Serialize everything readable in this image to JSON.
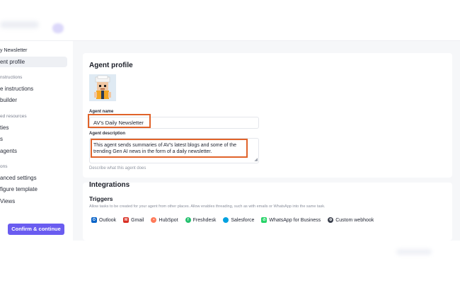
{
  "sidebar": {
    "items": [
      {
        "label": "y Newsletter",
        "kind": "item"
      },
      {
        "label": "ent profile",
        "kind": "item",
        "active": true
      },
      {
        "label": "nstructions",
        "kind": "section"
      },
      {
        "label": "e instructions",
        "kind": "item"
      },
      {
        "label": "builder",
        "kind": "item"
      },
      {
        "label": "ed resources",
        "kind": "section"
      },
      {
        "label": "ties",
        "kind": "item"
      },
      {
        "label": "s",
        "kind": "item"
      },
      {
        "label": "agents",
        "kind": "item"
      },
      {
        "label": "ons",
        "kind": "section"
      },
      {
        "label": "anced settings",
        "kind": "item"
      },
      {
        "label": "figure template",
        "kind": "item"
      },
      {
        "label": "Views",
        "kind": "item"
      }
    ],
    "confirm_label": "Confirm & continue"
  },
  "profile": {
    "heading": "Agent profile",
    "name_label": "Agent name",
    "name_value": "AV's Daily Newsletter",
    "desc_label": "Agent description",
    "desc_value": "This agent sends summaries of AV's latest blogs and some of the trending Gen AI news in the form of a daily newsletter.",
    "helper": "Describe what this agent does"
  },
  "integrations": {
    "heading": "Integrations",
    "triggers_heading": "Triggers",
    "triggers_desc": "Allow tasks to be created for your agent from other places. Allow enables threading, such as with emails or WhatsApp into the same task.",
    "triggers": [
      {
        "label": "Outlook",
        "icon": "outlook-icon",
        "color": "#0a64c8"
      },
      {
        "label": "Gmail",
        "icon": "gmail-icon",
        "color": "#d93025"
      },
      {
        "label": "HubSpot",
        "icon": "hubspot-icon",
        "color": "#ff7a59"
      },
      {
        "label": "Freshdesk",
        "icon": "freshdesk-icon",
        "color": "#25c16f"
      },
      {
        "label": "Salesforce",
        "icon": "salesforce-icon",
        "color": "#00a1e0"
      },
      {
        "label": "WhatsApp for Business",
        "icon": "whatsapp-icon",
        "color": "#25d366"
      },
      {
        "label": "Custom webhook",
        "icon": "webhook-icon",
        "color": "#3a3f4c"
      }
    ]
  },
  "colors": {
    "accent": "#6a5cf0",
    "highlight": "#e0632a",
    "background": "#f6f7f9"
  }
}
